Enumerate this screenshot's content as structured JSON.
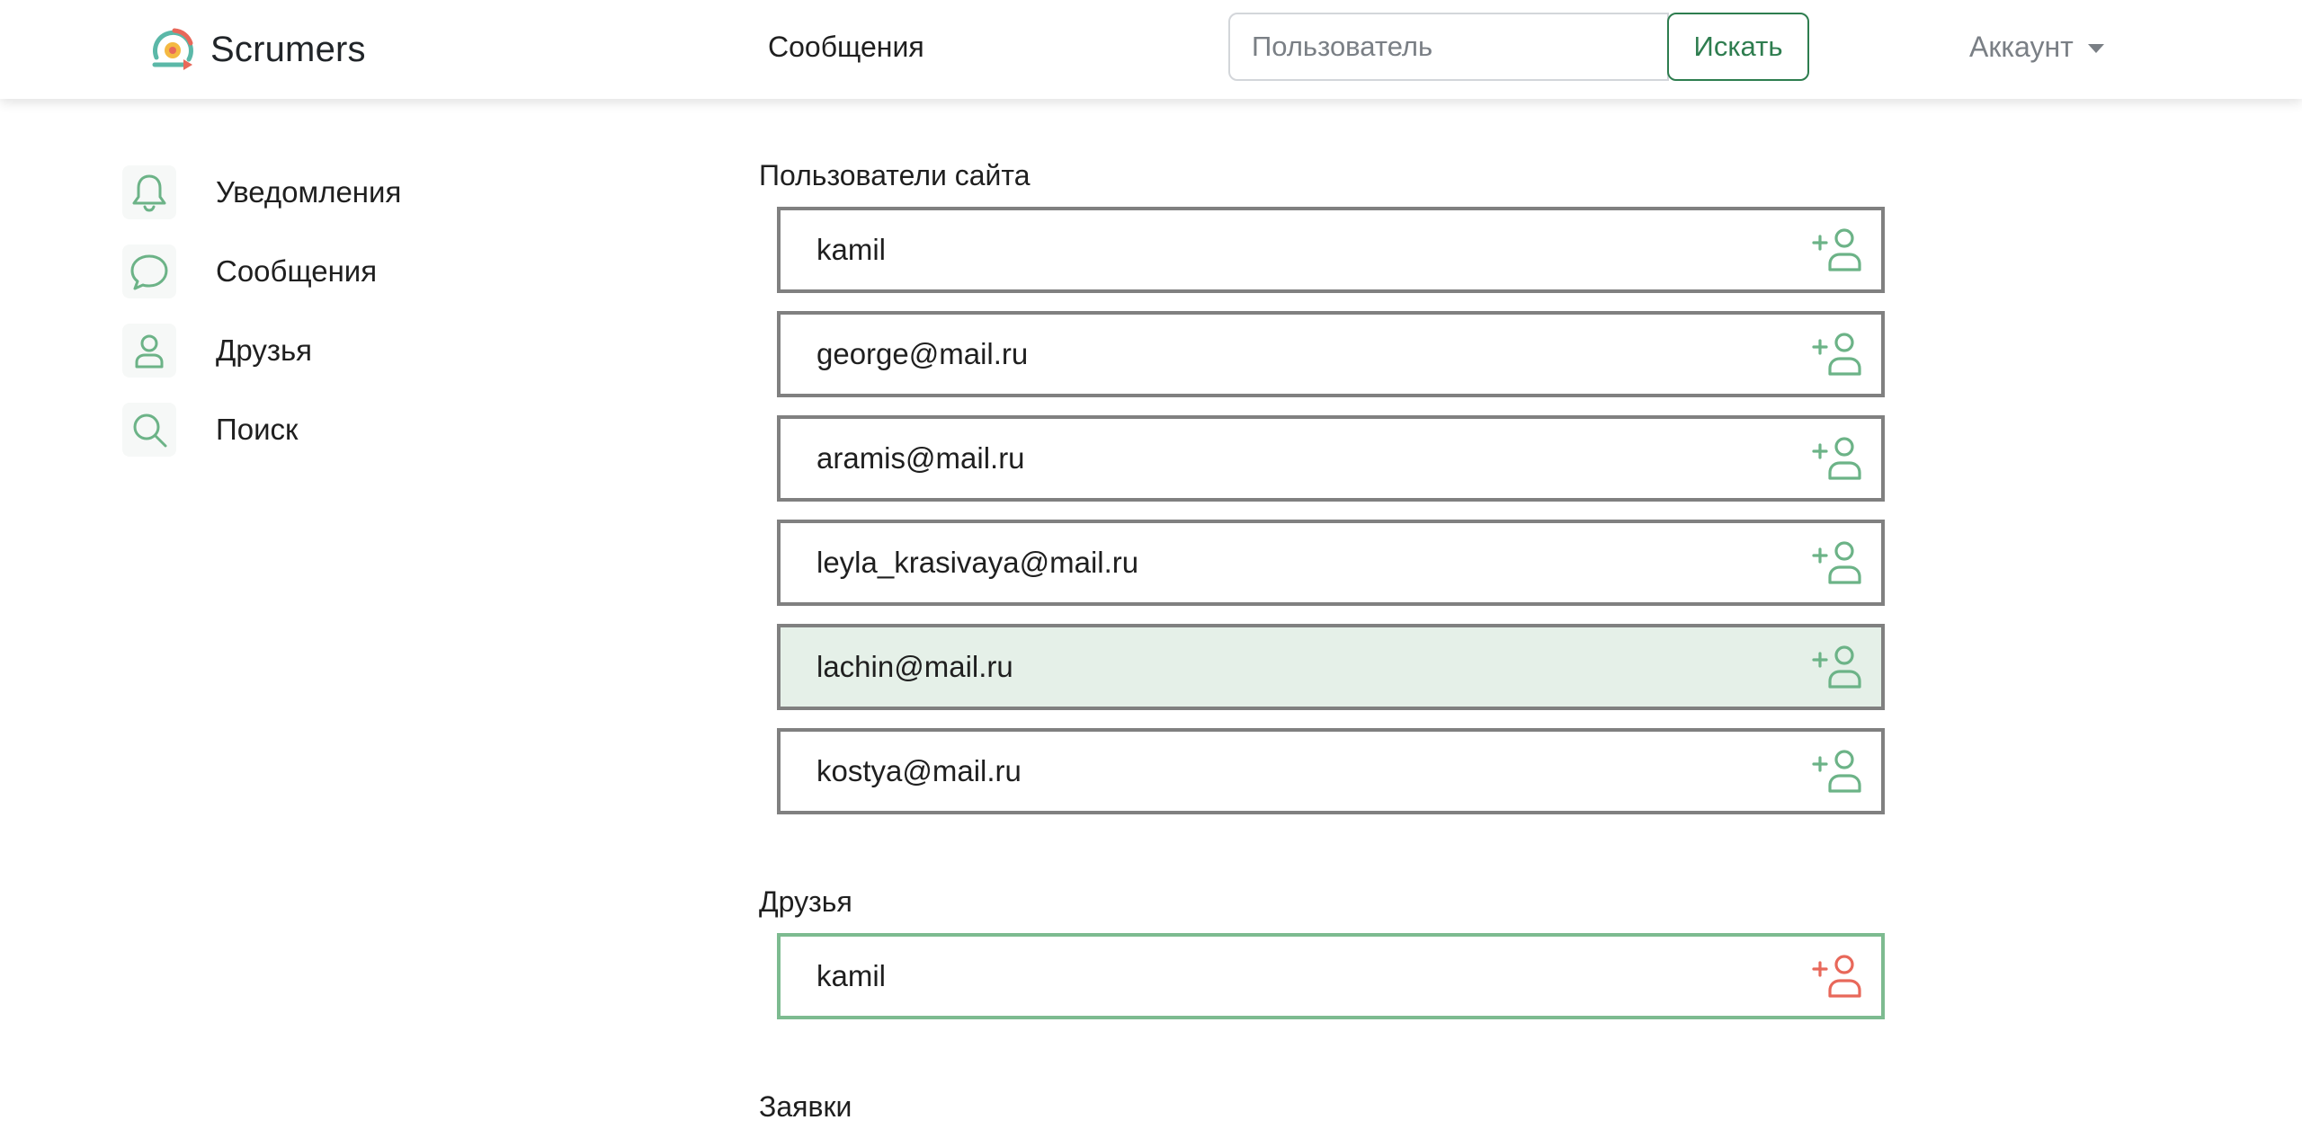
{
  "brand": {
    "name": "Scrumers"
  },
  "navbar": {
    "messages_link": "Сообщения",
    "search_placeholder": "Пользователь",
    "search_button": "Искать",
    "account_label": "Аккаунт"
  },
  "sidebar": {
    "items": [
      {
        "label": "Уведомления",
        "icon": "bell-icon"
      },
      {
        "label": "Сообщения",
        "icon": "chat-bubble-icon"
      },
      {
        "label": "Друзья",
        "icon": "user-icon"
      },
      {
        "label": "Поиск",
        "icon": "search-icon"
      }
    ]
  },
  "main": {
    "site_users_title": "Пользователи сайта",
    "site_users": [
      {
        "name": "kamil",
        "icon": "add-user-icon"
      },
      {
        "name": "george@mail.ru",
        "icon": "add-user-icon"
      },
      {
        "name": "aramis@mail.ru",
        "icon": "add-user-icon"
      },
      {
        "name": "leyla_krasivaya@mail.ru",
        "icon": "add-user-icon"
      },
      {
        "name": "lachin@mail.ru",
        "icon": "add-user-icon",
        "highlighted": true
      },
      {
        "name": "kostya@mail.ru",
        "icon": "add-user-icon"
      }
    ],
    "friends_title": "Друзья",
    "friends": [
      {
        "name": "kamil",
        "icon": "add-user-icon"
      }
    ],
    "requests_title": "Заявки"
  },
  "colors": {
    "accent_green": "#6cb387",
    "button_green": "#2e7d4f",
    "friend_icon_red": "#e8685a",
    "row_highlight": "#e5f0e8",
    "row_border": "#808080",
    "friend_border": "#7dbb90"
  }
}
